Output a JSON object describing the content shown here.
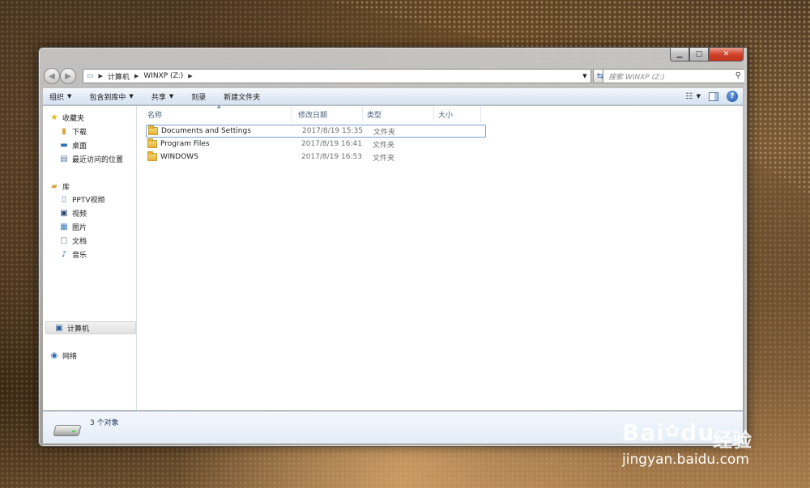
{
  "window": {
    "caption_buttons": [
      "minimize-icon",
      "maximize-icon",
      "close-icon"
    ]
  },
  "address_bar": {
    "segments": [
      "计算机",
      "WINXP (Z:)"
    ],
    "search_placeholder": "搜索 WINXP (Z:)"
  },
  "command_bar": {
    "items": [
      {
        "label": "组织",
        "dropdown": true
      },
      {
        "label": "包含到库中",
        "dropdown": true
      },
      {
        "label": "共享",
        "dropdown": true
      },
      {
        "label": "刻录",
        "dropdown": false
      },
      {
        "label": "新建文件夹",
        "dropdown": false
      }
    ]
  },
  "nav_pane": {
    "favorites": {
      "label": "收藏夹",
      "items": [
        "下载",
        "桌面",
        "最近访问的位置"
      ]
    },
    "libraries": {
      "label": "库",
      "items": [
        "PPTV视频",
        "视频",
        "图片",
        "文档",
        "音乐"
      ]
    },
    "computer": {
      "label": "计算机"
    },
    "network": {
      "label": "网络"
    }
  },
  "columns": {
    "name": "名称",
    "date": "修改日期",
    "type": "类型",
    "size": "大小"
  },
  "files": [
    {
      "name": "Documents and Settings",
      "date": "2017/8/19 15:35",
      "type": "文件夹",
      "size": ""
    },
    {
      "name": "Program Files",
      "date": "2017/8/19 16:41",
      "type": "文件夹",
      "size": ""
    },
    {
      "name": "WINDOWS",
      "date": "2017/8/19 16:53",
      "type": "文件夹",
      "size": ""
    }
  ],
  "details": {
    "object_count": "3 个对象"
  },
  "watermark": {
    "logo": "Bai",
    "logo_tail": "du",
    "logo_jy": "经验",
    "url": "jingyan.baidu.com"
  }
}
